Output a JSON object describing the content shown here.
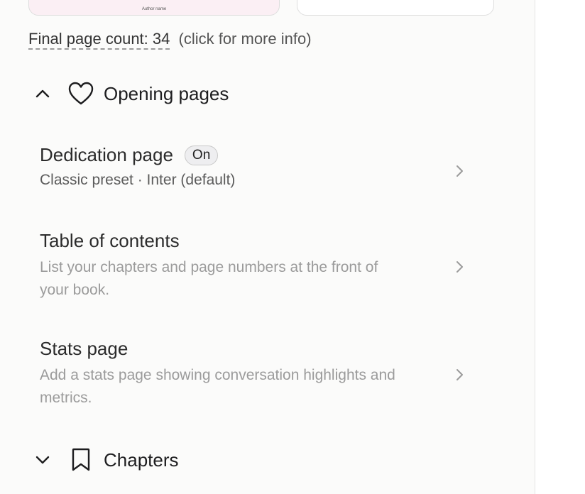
{
  "thumbnails": {
    "left_caption": "Author name"
  },
  "page_count": {
    "label": "Final page count: 34",
    "more_info": "(click for more info)"
  },
  "opening_section": {
    "title": "Opening pages",
    "icon": "heart-icon",
    "expanded": true
  },
  "rows": [
    {
      "title": "Dedication page",
      "badge": "On",
      "subtitle": "Classic preset · Inter (default)"
    },
    {
      "title": "Table of contents",
      "subtitle": "List your chapters and page numbers at the front of your book."
    },
    {
      "title": "Stats page",
      "subtitle": "Add a stats page showing conversation highlights and metrics."
    }
  ],
  "chapters_section": {
    "title": "Chapters",
    "icon": "bookmark-icon",
    "expanded": false
  }
}
